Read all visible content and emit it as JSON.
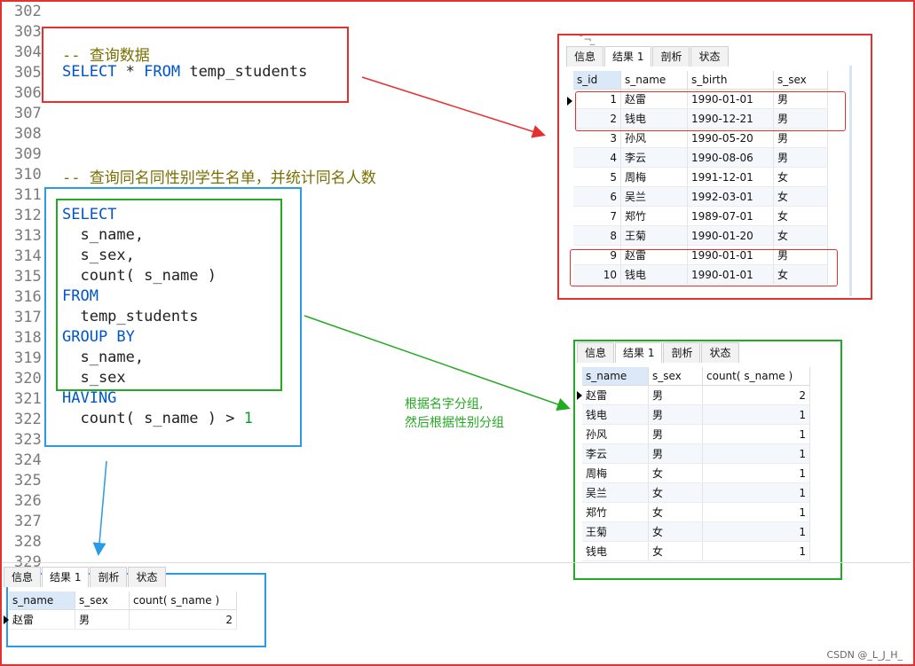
{
  "line_numbers": [
    "302",
    "303",
    "304",
    "305",
    "306",
    "307",
    "308",
    "309",
    "310",
    "311",
    "312",
    "313",
    "314",
    "315",
    "316",
    "317",
    "318",
    "319",
    "320",
    "321",
    "322",
    "323",
    "324",
    "325",
    "326",
    "327",
    "328",
    "329"
  ],
  "sql1": {
    "comment": "-- 查询数据",
    "kw_select": "SELECT",
    "star": " * ",
    "kw_from": "FROM",
    "table": " temp_students"
  },
  "sql2": {
    "comment": "-- 查询同名同性别学生名单，并统计同名人数",
    "select": "SELECT",
    "l1": "  s_name,",
    "l2": "  s_sex,",
    "l3": "  count( s_name )",
    "from": "FROM",
    "l4": "  temp_students",
    "group": "GROUP BY",
    "l5": "  s_name,",
    "l6": "  s_sex",
    "having": "HAVING",
    "l7a": "  count( s_name ) > ",
    "l7b": "1"
  },
  "tabs": {
    "info": "信息",
    "result": "结果 1",
    "profile": "剖析",
    "status": "状态"
  },
  "grid1": {
    "partial_header": "¯¬ ̲",
    "columns": [
      "s_id",
      "s_name",
      "s_birth",
      "s_sex"
    ],
    "rows": [
      [
        "1",
        "赵雷",
        "1990-01-01",
        "男"
      ],
      [
        "2",
        "钱电",
        "1990-12-21",
        "男"
      ],
      [
        "3",
        "孙风",
        "1990-05-20",
        "男"
      ],
      [
        "4",
        "李云",
        "1990-08-06",
        "男"
      ],
      [
        "5",
        "周梅",
        "1991-12-01",
        "女"
      ],
      [
        "6",
        "吴兰",
        "1992-03-01",
        "女"
      ],
      [
        "7",
        "郑竹",
        "1989-07-01",
        "女"
      ],
      [
        "8",
        "王菊",
        "1990-01-20",
        "女"
      ],
      [
        "9",
        "赵雷",
        "1990-01-01",
        "男"
      ],
      [
        "10",
        "钱电",
        "1990-01-01",
        "女"
      ]
    ]
  },
  "grid2": {
    "columns": [
      "s_name",
      "s_sex",
      "count( s_name )"
    ],
    "rows": [
      [
        "赵雷",
        "男",
        "2"
      ],
      [
        "钱电",
        "男",
        "1"
      ],
      [
        "孙风",
        "男",
        "1"
      ],
      [
        "李云",
        "男",
        "1"
      ],
      [
        "周梅",
        "女",
        "1"
      ],
      [
        "吴兰",
        "女",
        "1"
      ],
      [
        "郑竹",
        "女",
        "1"
      ],
      [
        "王菊",
        "女",
        "1"
      ],
      [
        "钱电",
        "女",
        "1"
      ]
    ]
  },
  "grid3": {
    "columns": [
      "s_name",
      "s_sex",
      "count( s_name )"
    ],
    "rows": [
      [
        "赵雷",
        "男",
        "2"
      ]
    ]
  },
  "annotation": {
    "line1": "根据名字分组,",
    "line2": "然后根据性别分组"
  },
  "watermark": "CSDN @_L_J_H_",
  "colors": {
    "red": "#e53030",
    "blue": "#2a9be6",
    "green": "#22aa22",
    "keyword": "#0055cc",
    "comment": "#7a6f00"
  }
}
